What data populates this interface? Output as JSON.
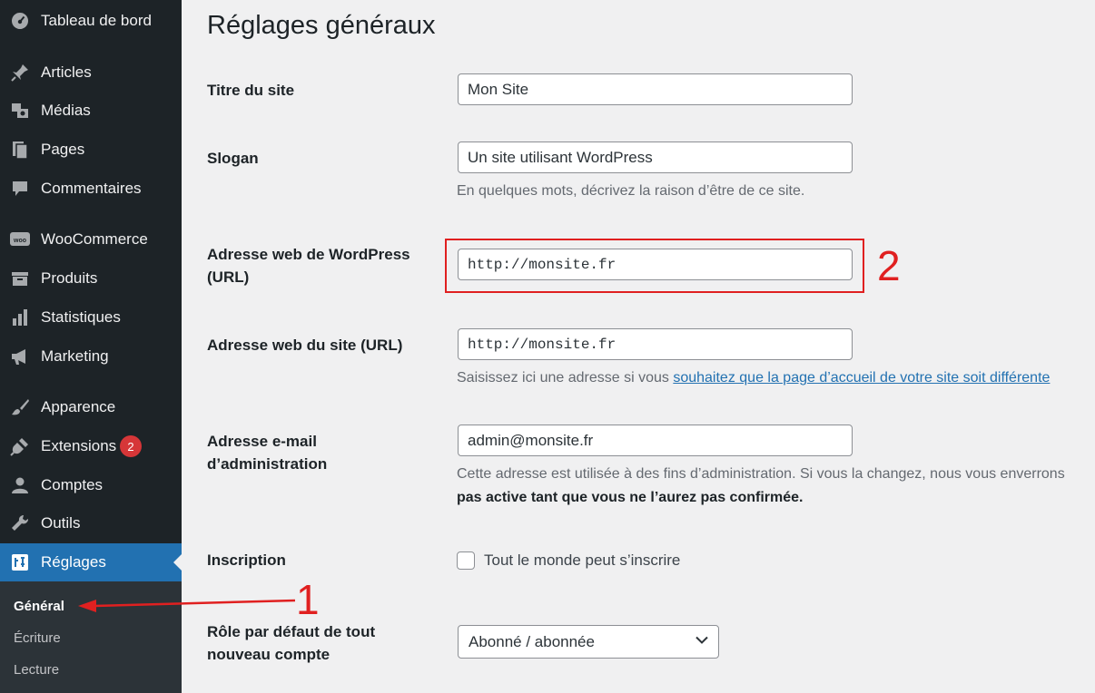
{
  "sidebar": {
    "items": [
      {
        "label": "Tableau de bord",
        "icon": "dashboard-icon"
      },
      {
        "label": "Articles",
        "icon": "pin-icon"
      },
      {
        "label": "Médias",
        "icon": "media-icon"
      },
      {
        "label": "Pages",
        "icon": "pages-icon"
      },
      {
        "label": "Commentaires",
        "icon": "comment-icon"
      },
      {
        "label": "WooCommerce",
        "icon": "woocommerce-icon"
      },
      {
        "label": "Produits",
        "icon": "products-icon"
      },
      {
        "label": "Statistiques",
        "icon": "stats-icon"
      },
      {
        "label": "Marketing",
        "icon": "megaphone-icon"
      },
      {
        "label": "Apparence",
        "icon": "brush-icon"
      },
      {
        "label": "Extensions",
        "icon": "plugin-icon",
        "badge": "2"
      },
      {
        "label": "Comptes",
        "icon": "user-icon"
      },
      {
        "label": "Outils",
        "icon": "wrench-icon"
      },
      {
        "label": "Réglages",
        "icon": "settings-icon",
        "active": true
      }
    ],
    "submenu": [
      {
        "label": "Général",
        "current": true
      },
      {
        "label": "Écriture"
      },
      {
        "label": "Lecture"
      }
    ]
  },
  "main": {
    "title": "Réglages généraux",
    "site_title": {
      "label": "Titre du site",
      "value": "Mon Site"
    },
    "tagline": {
      "label": "Slogan",
      "value": "Un site utilisant WordPress",
      "description": "En quelques mots, décrivez la raison d’être de ce site."
    },
    "wp_url": {
      "label_line1": "Adresse web de WordPress",
      "label_line2": "(URL)",
      "value": "http://monsite.fr"
    },
    "site_url": {
      "label": "Adresse web du site (URL)",
      "value": "http://monsite.fr",
      "description_prefix": "Saisissez ici une adresse si vous ",
      "description_link": "souhaitez que la page d’accueil de votre site soit différente"
    },
    "admin_email": {
      "label_line1": "Adresse e-mail",
      "label_line2": "d’administration",
      "value": "admin@monsite.fr",
      "description_line1": "Cette adresse est utilisée à des fins d’administration. Si vous la changez, nous vous enverrons",
      "description_line2": "pas active tant que vous ne l’aurez pas confirmée."
    },
    "membership": {
      "label": "Inscription",
      "checkbox_label": "Tout le monde peut s’inscrire",
      "checked": false
    },
    "default_role": {
      "label_line1": "Rôle par défaut de tout",
      "label_line2": "nouveau compte",
      "value": "Abonné / abonnée"
    }
  },
  "annotations": {
    "step1": "1",
    "step2": "2",
    "color": "#e02020"
  },
  "colors": {
    "sidebar_bg": "#1d2327",
    "active_bg": "#2271b1",
    "badge": "#d63638",
    "link": "#2271b1"
  }
}
